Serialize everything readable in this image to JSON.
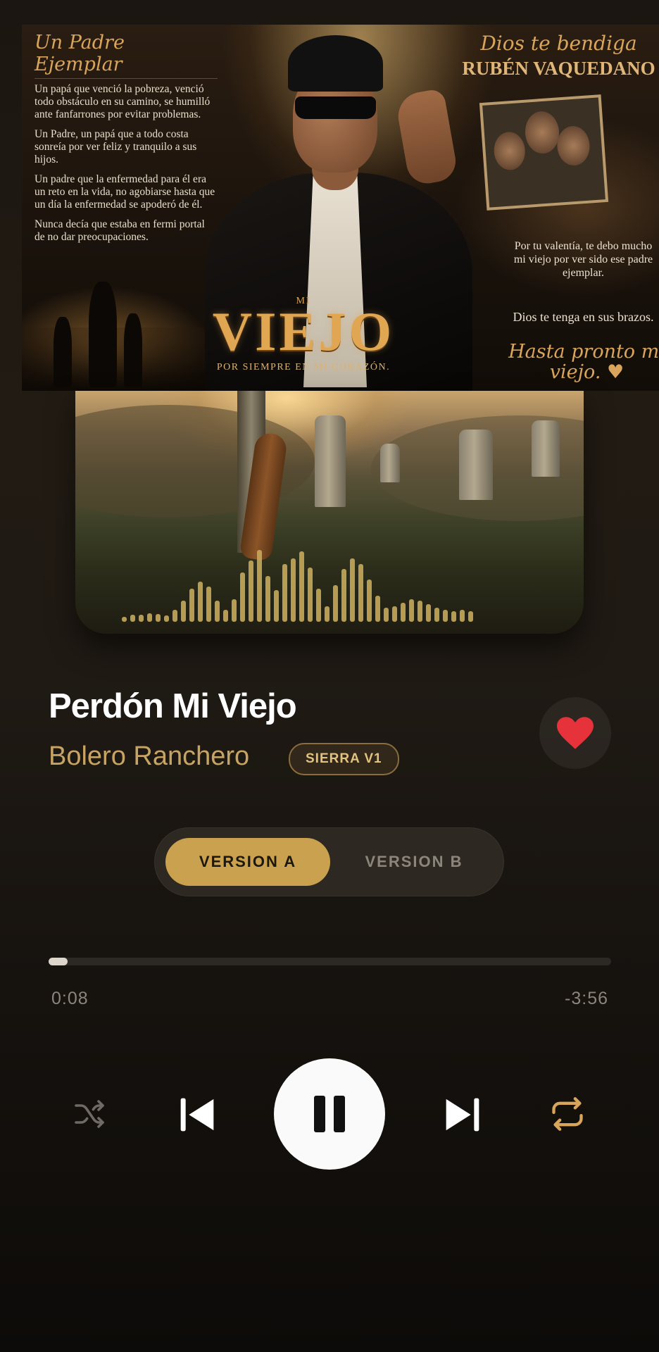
{
  "banner": {
    "left_title": "Un Padre Ejemplar",
    "left_paragraphs": [
      "Un papá que venció la pobreza, venció todo obstáculo en su camino, se humilló ante fanfarrones por evitar problemas.",
      "Un Padre, un papá que a todo costa sonreía por ver feliz y tranquilo a sus hijos.",
      "Un padre que la enfermedad para él era un reto en la vida, no agobiarse hasta que un día la enfermedad se apoderó de él.",
      "Nunca decía que estaba en fermi portal de no dar preocupaciones."
    ],
    "center_mi": "MI",
    "center_title": "VIEJO",
    "center_subtitle": "POR SIEMPRE EN MI CORAZÓN.",
    "right_title": "Dios te bendiga",
    "right_name": "RUBÉN VAQUEDANO",
    "right_quote": "Por tu valentía, te debo mucho mi viejo por ver sido ese padre ejemplar.",
    "right_blessing": "Dios te tenga en sus brazos.",
    "right_farewell": "Hasta pronto mi viejo. ♥"
  },
  "waveform": [
    6,
    8,
    8,
    10,
    9,
    7,
    14,
    24,
    38,
    46,
    40,
    24,
    14,
    26,
    56,
    70,
    82,
    52,
    36,
    66,
    72,
    80,
    62,
    38,
    18,
    42,
    60,
    72,
    66,
    48,
    30,
    16,
    18,
    22,
    26,
    24,
    20,
    16,
    14,
    12,
    14,
    12
  ],
  "song": {
    "title": "Perdón Mi Viejo",
    "artist": "Bolero Ranchero",
    "badge": "SIERRA V1",
    "liked": true
  },
  "versions": {
    "options": [
      "VERSION A",
      "VERSION B"
    ],
    "selected": "VERSION A"
  },
  "progress": {
    "current": "0:08",
    "remaining": "-3:56",
    "fraction": 0.034
  },
  "controls": {
    "shuffle_icon": "shuffle-icon",
    "prev_icon": "skip-previous-icon",
    "play_state_icon": "pause-icon",
    "next_icon": "skip-next-icon",
    "repeat_icon": "repeat-icon"
  },
  "colors": {
    "accent": "#c9a14f",
    "heart": "#e5323b",
    "repeat_active": "#d9a55b"
  }
}
